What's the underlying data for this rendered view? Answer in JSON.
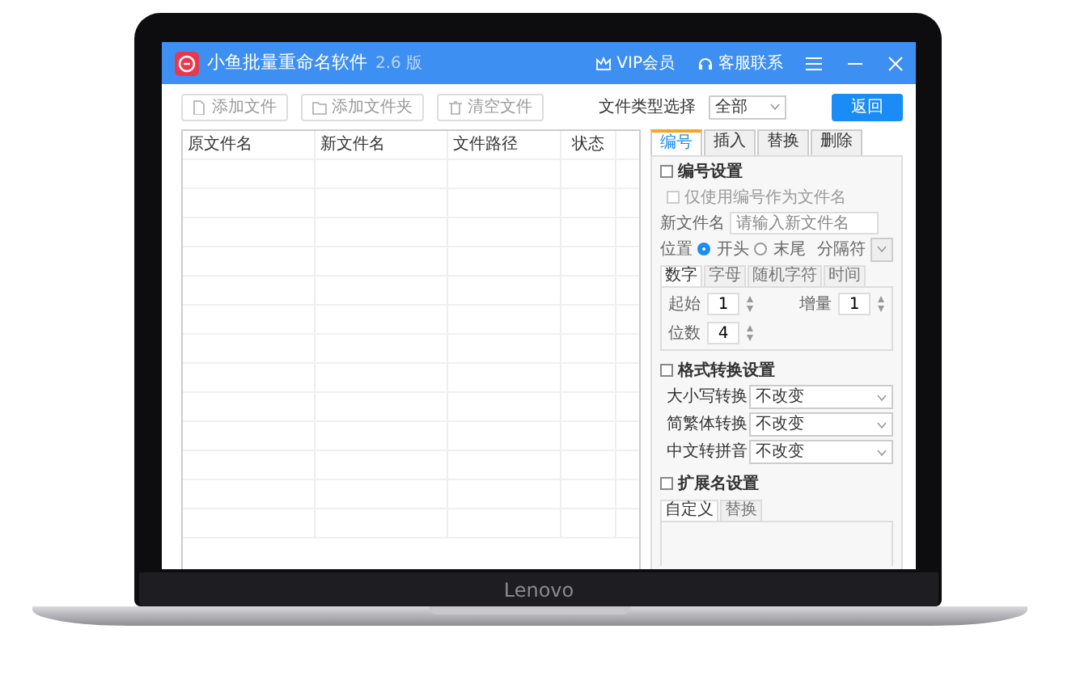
{
  "window": {
    "title": "小鱼批量重命名软件",
    "version": "2.6 版",
    "header_links": [
      {
        "kind": "vip",
        "label": "VIP会员"
      },
      {
        "kind": "support",
        "label": "客服联系"
      }
    ]
  },
  "toolbar": {
    "buttons": [
      {
        "kind": "file",
        "label": "添加文件"
      },
      {
        "kind": "folder",
        "label": "添加文件夹"
      },
      {
        "kind": "clear",
        "label": "清空文件"
      }
    ],
    "filter": {
      "label": "文件类型选择",
      "value": "全部"
    },
    "back_button": "返回"
  },
  "table": {
    "columns": [
      "原文件名",
      "新文件名",
      "文件路径",
      "状态"
    ]
  },
  "panel": {
    "tabs": [
      {
        "label": "编号",
        "selected": true
      },
      {
        "label": "插入",
        "selected": false
      },
      {
        "label": "替换",
        "selected": false
      },
      {
        "label": "删除",
        "selected": false
      }
    ],
    "numbering": {
      "title": "编号设置",
      "checked": false,
      "only_number": {
        "label": "仅使用编号作为文件名",
        "checked": false,
        "disabled": true
      },
      "new_name": {
        "label": "新文件名",
        "placeholder": "请输入新文件名"
      },
      "position": {
        "label": "位置",
        "options": [
          {
            "label": "开头",
            "selected": true
          },
          {
            "label": "末尾",
            "selected": false
          }
        ],
        "separator_label": "分隔符"
      },
      "subtabs": [
        {
          "label": "数字",
          "selected": true
        },
        {
          "label": "字母",
          "selected": false
        },
        {
          "label": "随机字符",
          "selected": false
        },
        {
          "label": "时间",
          "selected": false
        }
      ],
      "fields": [
        {
          "label": "起始",
          "value": "1"
        },
        {
          "label": "增量",
          "value": "1"
        },
        {
          "label": "位数",
          "value": "4"
        }
      ]
    },
    "format": {
      "title": "格式转换设置",
      "checked": false,
      "rows": [
        {
          "label": "大小写转换",
          "value": "不改变"
        },
        {
          "label": "简繁体转换",
          "value": "不改变"
        },
        {
          "label": "中文转拼音",
          "value": "不改变"
        }
      ]
    },
    "extension": {
      "title": "扩展名设置",
      "checked": false,
      "subtabs": [
        {
          "label": "自定义",
          "selected": true
        },
        {
          "label": "替换",
          "selected": false
        }
      ]
    }
  },
  "brand": "Lenovo"
}
